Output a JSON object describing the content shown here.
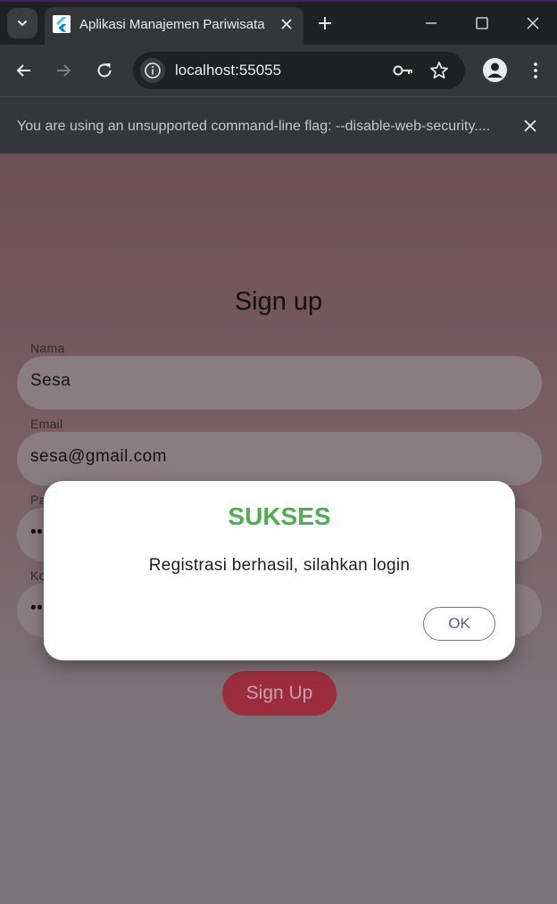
{
  "browser": {
    "tab_title": "Aplikasi Manajemen Pariwisata",
    "url": "localhost:55055",
    "infobar_message": "You are using an unsupported command-line flag: --disable-web-security...."
  },
  "signup": {
    "title": "Sign up",
    "fields": [
      {
        "label": "Nama",
        "value": "Sesa"
      },
      {
        "label": "Email",
        "value": "sesa@gmail.com"
      },
      {
        "label": "Pa",
        "value": "••"
      },
      {
        "label": "Ko",
        "value": "••"
      }
    ],
    "button_label": "Sign Up"
  },
  "dialog": {
    "title": "SUKSES",
    "message": "Registrasi berhasil, silahkan login",
    "ok_label": "OK"
  },
  "colors": {
    "accent_success": "#4caf50",
    "primary_button": "#9b2d3f",
    "dialog_button_text": "#6750a4"
  },
  "icons": [
    "tab-search-icon",
    "flutter-icon",
    "close-icon",
    "plus-icon",
    "minimize-icon",
    "maximize-icon",
    "back-icon",
    "forward-icon",
    "reload-icon",
    "info-icon",
    "key-icon",
    "star-icon",
    "profile-icon",
    "more-vert-icon"
  ]
}
